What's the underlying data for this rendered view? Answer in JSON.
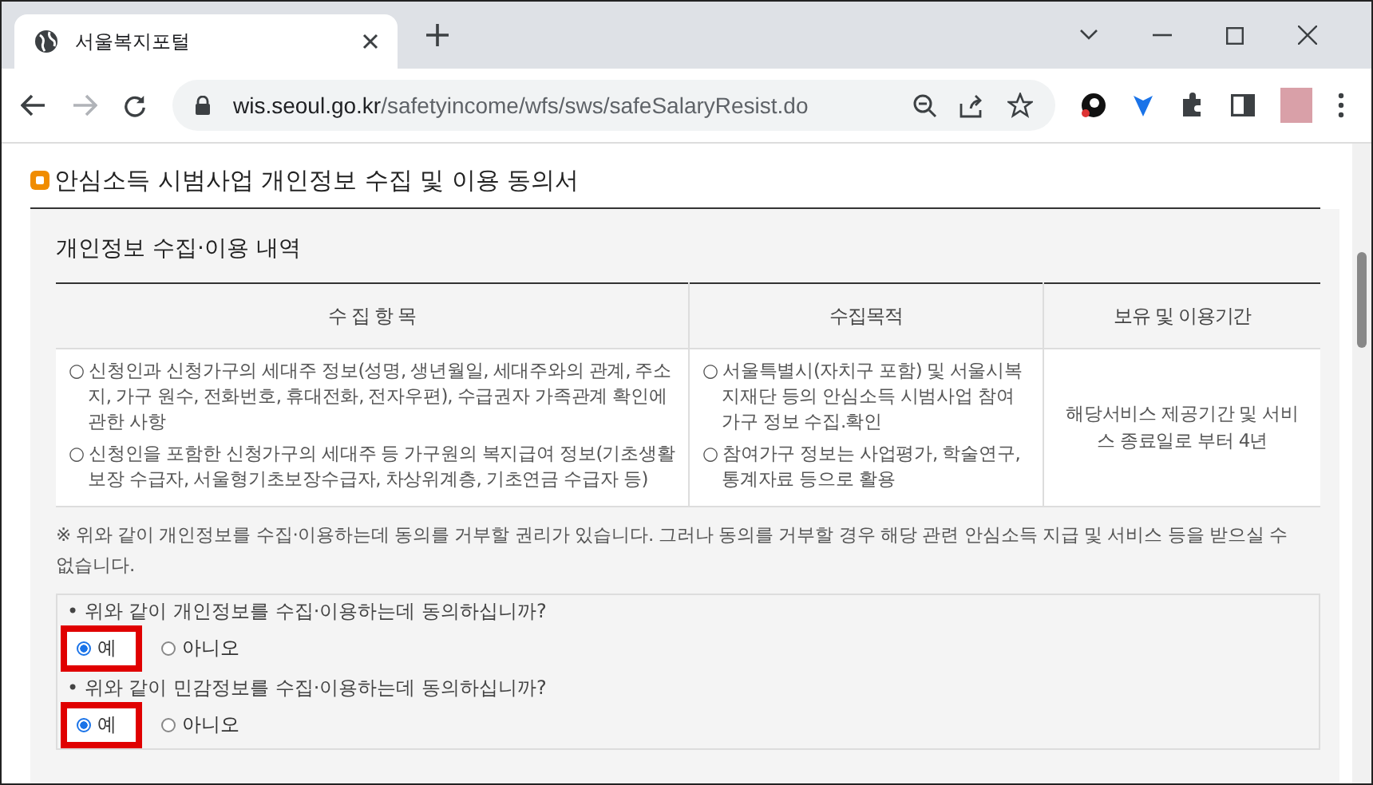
{
  "browser": {
    "tab_title": "서울복지포털",
    "url_host": "wis.seoul.go.kr",
    "url_path": "/safetyincome/wfs/sws/safeSalaryResist.do"
  },
  "page_title": "안심소득 시범사업 개인정보 수집 및 이용 동의서",
  "section_title": "개인정보 수집·이용 내역",
  "table": {
    "columns": [
      "수 집 항 목",
      "수집목적",
      "보유 및 이용기간"
    ],
    "row": {
      "items": [
        "○ 신청인과 신청가구의 세대주 정보(성명, 생년월일, 세대주와의 관계, 주소지, 가구 원수, 전화번호, 휴대전화, 전자우편), 수급권자 가족관계 확인에 관한 사항",
        "○ 신청인을 포함한 신청가구의 세대주 등 가구원의 복지급여 정보(기초생활보장 수급자, 서울형기초보장수급자, 차상위계층, 기초연금 수급자 등)"
      ],
      "purposes": [
        "○ 서울특별시(자치구 포함) 및 서울시복지재단 등의 안심소득 시범사업 참여가구 정보 수집.확인",
        "○ 참여가구 정보는 사업평가, 학술연구, 통계자료 등으로 활용"
      ],
      "period": "해당서비스 제공기간 및 서비스 종료일로 부터 4년"
    }
  },
  "notice": "※ 위와 같이 개인정보를 수집·이용하는데 동의를 거부할 권리가 있습니다. 그러나 동의를 거부할 경우 해당 관련 안심소득 지급 및 서비스 등을 받으실 수 없습니다.",
  "questions": [
    {
      "text": "• 위와 같이 개인정보를 수집·이용하는데 동의하십니까?",
      "options": [
        {
          "label": "예",
          "selected": true,
          "highlighted": true
        },
        {
          "label": "아니오",
          "selected": false,
          "highlighted": false
        }
      ]
    },
    {
      "text": "• 위와 같이 민감정보를 수집·이용하는데 동의하십니까?",
      "options": [
        {
          "label": "예",
          "selected": true,
          "highlighted": true
        },
        {
          "label": "아니오",
          "selected": false,
          "highlighted": false
        }
      ]
    }
  ]
}
